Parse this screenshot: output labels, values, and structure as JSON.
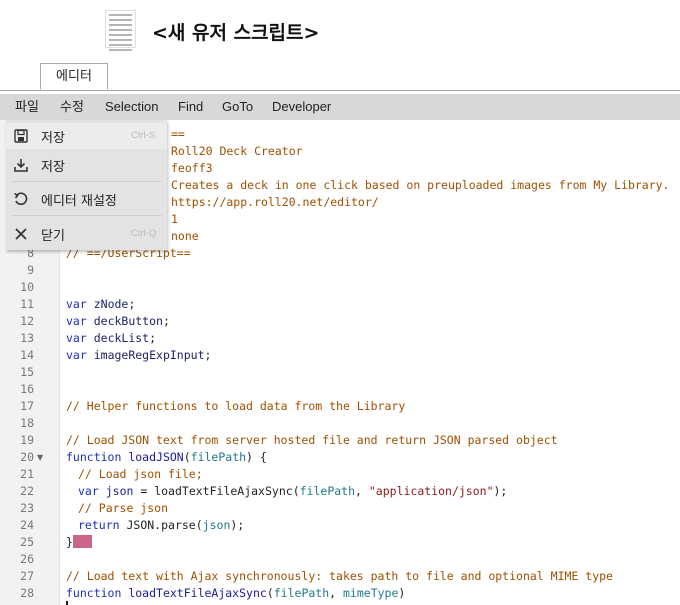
{
  "header": {
    "title": "<새 유저 스크립트>",
    "logo_icon": "userscript-document-logo-icon"
  },
  "tabs": [
    {
      "label": "에디터",
      "active": true
    }
  ],
  "menubar": [
    "파일",
    "수정",
    "Selection",
    "Find",
    "GoTo",
    "Developer"
  ],
  "file_menu": {
    "items": [
      {
        "label": "저장",
        "shortcut": "Ctrl-S",
        "icon": "floppy-disk-icon"
      },
      {
        "label": "저장",
        "shortcut": "",
        "icon": "download-icon"
      },
      {
        "label": "에디터 재설정",
        "shortcut": "",
        "icon": "undo-icon"
      },
      {
        "label": "닫기",
        "shortcut": "Ctrl-Q",
        "icon": "close-icon"
      }
    ]
  },
  "code": {
    "visible_line_numbers": [
      "8",
      "9",
      "10",
      "11",
      "12",
      "13",
      "14",
      "15",
      "16",
      "17",
      "18",
      "19",
      "20",
      "21",
      "22",
      "23",
      "24",
      "25",
      "26",
      "27",
      "28"
    ],
    "fold_marker_line": "20",
    "header_fragments": [
      "==",
      "Roll20 Deck Creator",
      "feoff3",
      "Creates a deck in one click based on preuploaded images from My Library.",
      "https://app.roll20.net/editor/",
      "1",
      "none",
      "// ==/UserScript=="
    ],
    "lines": {
      "l11_kw": "var",
      "l11_name": "zNode",
      "l12_kw": "var",
      "l12_name": "deckButton",
      "l13_kw": "var",
      "l13_name": "deckList",
      "l14_kw": "var",
      "l14_name": "imageRegExpInput",
      "l17": "// Helper functions to load data from the Library",
      "l19": "// Load JSON text from server hosted file and return JSON parsed object",
      "l20_kw": "function",
      "l20_fn": "loadJSON",
      "l20_p": "filePath",
      "l21": "// Load json file;",
      "l22_kw": "var",
      "l22_name": "json",
      "l22_fn": "loadTextFileAjaxSync",
      "l22_p": "filePath",
      "l22_str": "\"application/json\"",
      "l23": "// Parse json",
      "l24_kw": "return",
      "l24_call": "JSON.parse",
      "l24_arg": "json",
      "l25": "}",
      "l27": "// Load text with Ajax synchronously: takes path to file and optional MIME type",
      "l28_kw": "function",
      "l28_fn": "loadTextFileAjaxSync",
      "l28_p1": "filePath",
      "l28_p2": "mimeType"
    }
  }
}
